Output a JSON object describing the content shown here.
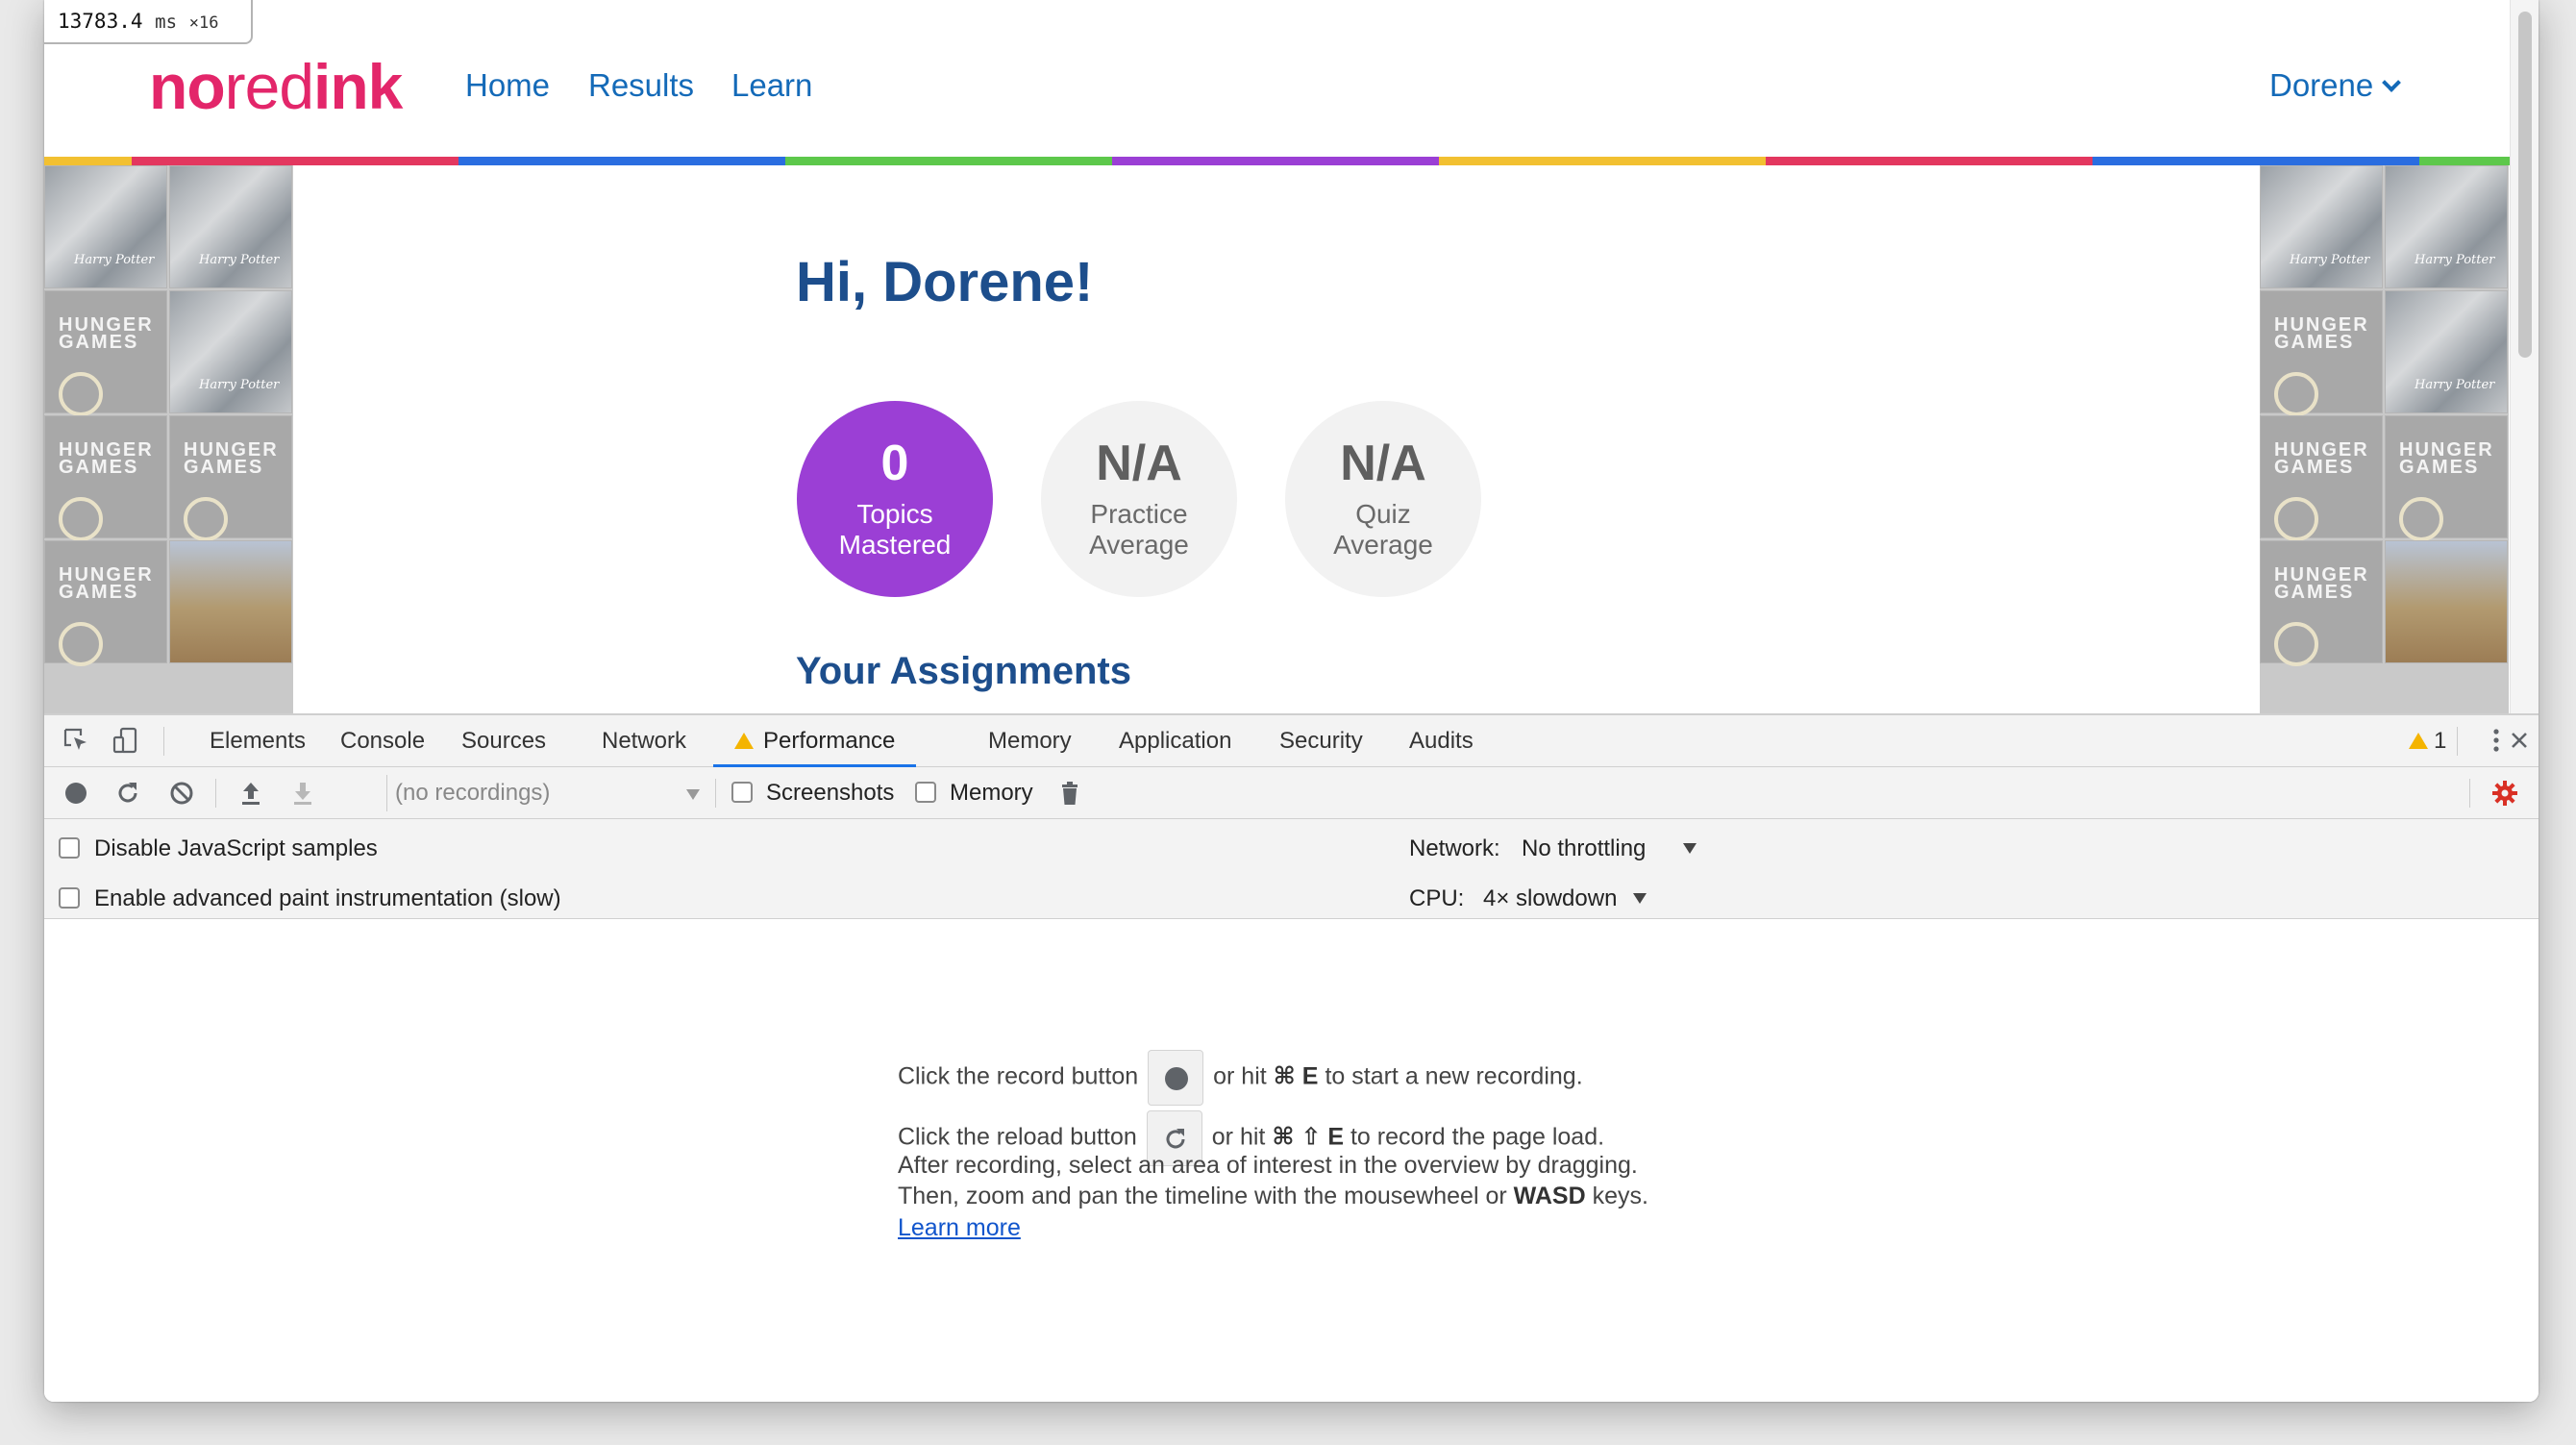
{
  "fps_meter": {
    "value": "13783.4",
    "unit": "ms",
    "multiplier": "×16"
  },
  "site": {
    "logo": {
      "part1": "no",
      "part2": "red",
      "part3": "ink"
    },
    "nav": {
      "home": "Home",
      "results": "Results",
      "learn": "Learn"
    },
    "user": "Dorene",
    "stripe_colors": [
      "#f2c031",
      "#e3375f",
      "#2a6de0",
      "#5dc84b",
      "#9b3fd5",
      "#f2c031",
      "#e3375f",
      "#2a6de0",
      "#5dc84b"
    ]
  },
  "dashboard": {
    "greeting": "Hi, Dorene!",
    "stats": [
      {
        "value": "0",
        "label": "Topics Mastered"
      },
      {
        "value": "N/A",
        "label": "Practice Average"
      },
      {
        "value": "N/A",
        "label": "Quiz Average"
      }
    ],
    "assignments_title": "Your Assignments",
    "colors": {
      "heading": "#1d4e8c",
      "mastered": "#9b3fd5",
      "link": "#146ab8",
      "brand": "#e3266a"
    }
  },
  "devtools": {
    "tabs": [
      "Elements",
      "Console",
      "Sources",
      "Network",
      "Performance",
      "Memory",
      "Application",
      "Security",
      "Audits"
    ],
    "active_tab": "Performance",
    "warning_count": "1",
    "toolbar": {
      "recordings_placeholder": "(no recordings)",
      "screenshots_label": "Screenshots",
      "memory_label": "Memory"
    },
    "settings": {
      "disable_js_samples": "Disable JavaScript samples",
      "advanced_paint": "Enable advanced paint instrumentation (slow)",
      "network_label": "Network:",
      "network_value": "No throttling",
      "cpu_label": "CPU:",
      "cpu_value": "4× slowdown"
    },
    "landing": {
      "record_pre": "Click the record button",
      "record_post_a": "or hit",
      "record_keys": "⌘ E",
      "record_post_b": "to start a new recording.",
      "reload_pre": "Click the reload button",
      "reload_post_a": "or hit",
      "reload_keys": "⌘ ⇧ E",
      "reload_post_b": "to record the page load.",
      "after_line1": "After recording, select an area of interest in the overview by dragging.",
      "after_line2_a": "Then, zoom and pan the timeline with the mousewheel or",
      "after_line2_keys": "WASD",
      "after_line2_b": "keys.",
      "learn_more": "Learn more"
    },
    "colors": {
      "accent": "#1a73e8",
      "warning": "#f4b400",
      "settings_gear": "#d93025"
    }
  }
}
